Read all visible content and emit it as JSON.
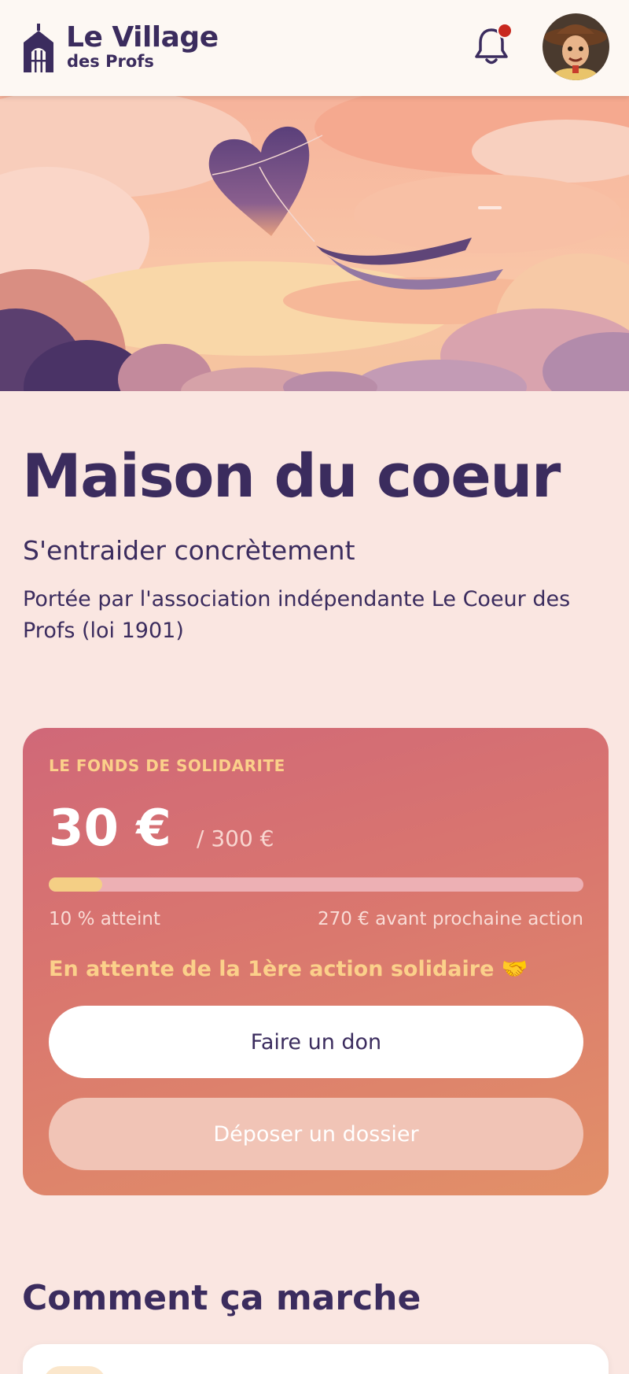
{
  "header": {
    "logo_title": "Le Village",
    "logo_subtitle": "des Profs",
    "notification_icon": "bell-icon",
    "has_unread": true,
    "colors": {
      "brand": "#3b2c5e",
      "notification_dot": "#c8281e",
      "background": "#fdf8f3"
    }
  },
  "page": {
    "title": "Maison du coeur",
    "subtitle": "S'entraider concrètement",
    "description": "Portée par l'association indépendante Le Coeur des Profs (loi 1901)"
  },
  "fund": {
    "eyebrow": "LE FONDS DE SOLIDARITE",
    "amount": "30 €",
    "goal": "/ 300 €",
    "progress_fraction": 0.1,
    "percent_label": "10 % atteint",
    "remaining_label": "270 € avant prochaine action",
    "status": "En attente de la 1ère action solidaire 🤝",
    "donate_label": "Faire un don",
    "submit_label": "Déposer un dossier",
    "colors": {
      "accent": "#f4cf85",
      "card_start": "#d06878",
      "card_end": "#e29068"
    }
  },
  "how_it_works": {
    "title": "Comment ça marche"
  }
}
